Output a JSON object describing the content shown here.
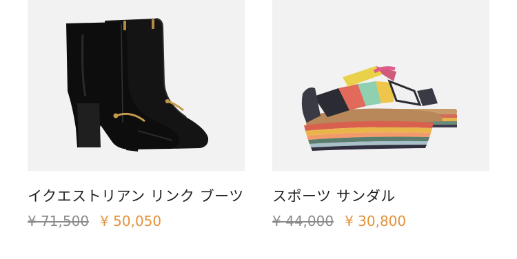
{
  "products": [
    {
      "name": "イクエストリアン リンク ブーツ",
      "original_price": "¥ 71,500",
      "sale_price": "¥ 50,050",
      "image": "ankle-boots"
    },
    {
      "name": "スポーツ サンダル",
      "original_price": "¥ 44,000",
      "sale_price": "¥ 30,800",
      "image": "platform-sport-sandal"
    }
  ],
  "colors": {
    "image_bg": "#f2f2f2",
    "name_text": "#222222",
    "original_price": "#8a8a8a",
    "sale_price": "#e3923a"
  }
}
